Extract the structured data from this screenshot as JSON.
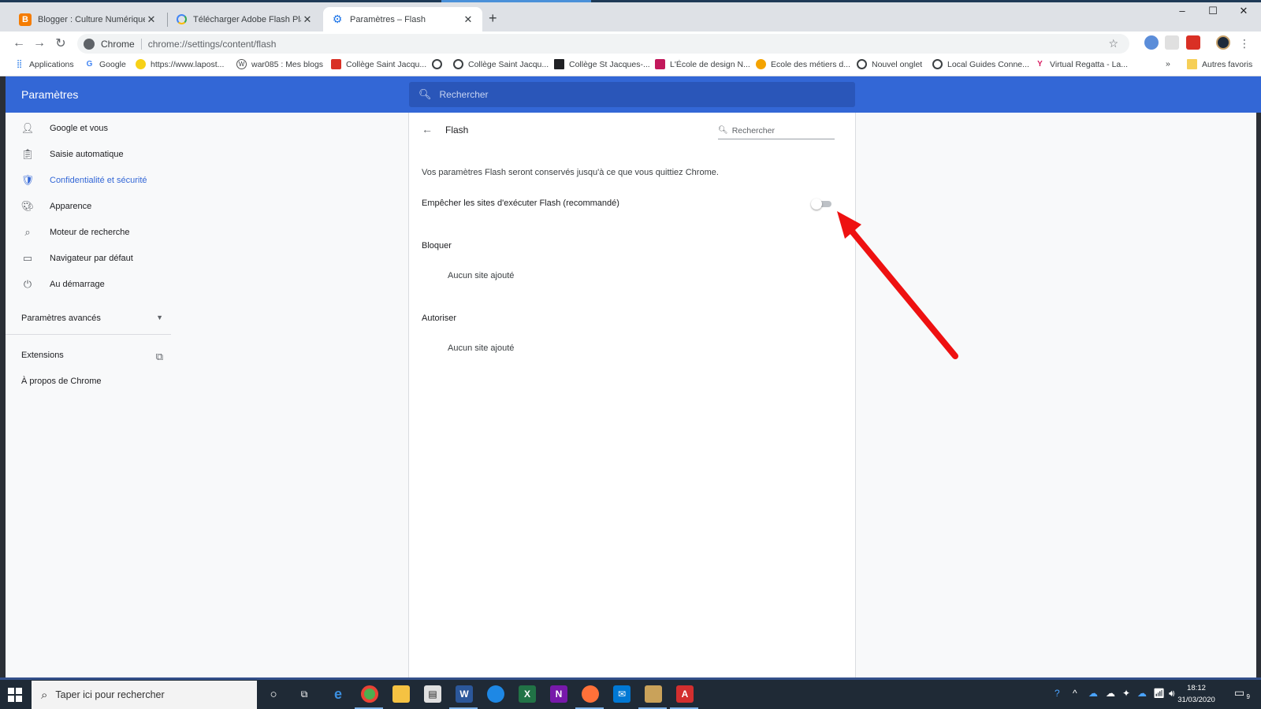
{
  "browser": {
    "tabs": [
      {
        "label": "Blogger : Culture Numérique - To",
        "icon": "blogger-icon",
        "color": "#f57c00"
      },
      {
        "label": "Télécharger Adobe Flash Player",
        "icon": "google-icon",
        "color": "#4285f4"
      },
      {
        "label": "Paramètres – Flash",
        "icon": "gear-icon",
        "color": "#1a73e8",
        "active": true
      }
    ],
    "new_tab": "+",
    "window_controls": [
      "–",
      "☐",
      "✕"
    ],
    "omnibox": {
      "chip": "Chrome",
      "url": "chrome://settings/content/flash"
    },
    "bookmarks": [
      {
        "label": "Applications",
        "icon": "apps-grid-icon"
      },
      {
        "label": "Google",
        "icon": "google-icon"
      },
      {
        "label": "https://www.lapost...",
        "icon": "laposte-icon"
      },
      {
        "label": "war085 : Mes blogs",
        "icon": "wordpress-icon"
      },
      {
        "label": "Collège Saint Jacqu...",
        "icon": "bookmark-red-icon"
      },
      {
        "label": "",
        "icon": "globe-icon"
      },
      {
        "label": "Collège Saint Jacqu...",
        "icon": "globe-icon"
      },
      {
        "label": "Collège St Jacques-...",
        "icon": "bookmark-dark-icon"
      },
      {
        "label": "L'École de design N...",
        "icon": "bookmark-red-icon"
      },
      {
        "label": "Ecole des métiers d...",
        "icon": "bookmark-orange-icon"
      },
      {
        "label": "Nouvel onglet",
        "icon": "globe-icon"
      },
      {
        "label": "Local Guides Conne...",
        "icon": "globe-icon"
      },
      {
        "label": "Virtual Regatta - La...",
        "icon": "regatta-icon"
      }
    ],
    "bookmarks_overflow": "»",
    "other_bookmarks": "Autres favoris"
  },
  "settings": {
    "header_title": "Paramètres",
    "search_placeholder": "Rechercher",
    "nav": [
      {
        "label": "Google et vous",
        "icon": "person-icon"
      },
      {
        "label": "Saisie automatique",
        "icon": "clipboard-icon"
      },
      {
        "label": "Confidentialité et sécurité",
        "icon": "shield-icon",
        "active": true
      },
      {
        "label": "Apparence",
        "icon": "palette-icon"
      },
      {
        "label": "Moteur de recherche",
        "icon": "search-icon"
      },
      {
        "label": "Navigateur par défaut",
        "icon": "browser-window-icon"
      },
      {
        "label": "Au démarrage",
        "icon": "power-icon"
      }
    ],
    "advanced": "Paramètres avancés",
    "extensions": "Extensions",
    "about": "À propos de Chrome",
    "page": {
      "title": "Flash",
      "search_placeholder": "Rechercher",
      "note": "Vos paramètres Flash seront conservés jusqu'à ce que vous quittiez Chrome.",
      "toggle_label": "Empêcher les sites d'exécuter Flash (recommandé)",
      "toggle_on": false,
      "block_title": "Bloquer",
      "block_empty": "Aucun site ajouté",
      "allow_title": "Autoriser",
      "allow_empty": "Aucun site ajouté"
    },
    "accent": "#3367d6"
  },
  "annotation": {
    "color": "#ee1111",
    "shape": "arrow pointing to toggle"
  },
  "taskbar": {
    "search_placeholder": "Taper ici pour rechercher",
    "time": "18:12",
    "date": "31/03/2020",
    "notification_count": "9"
  }
}
